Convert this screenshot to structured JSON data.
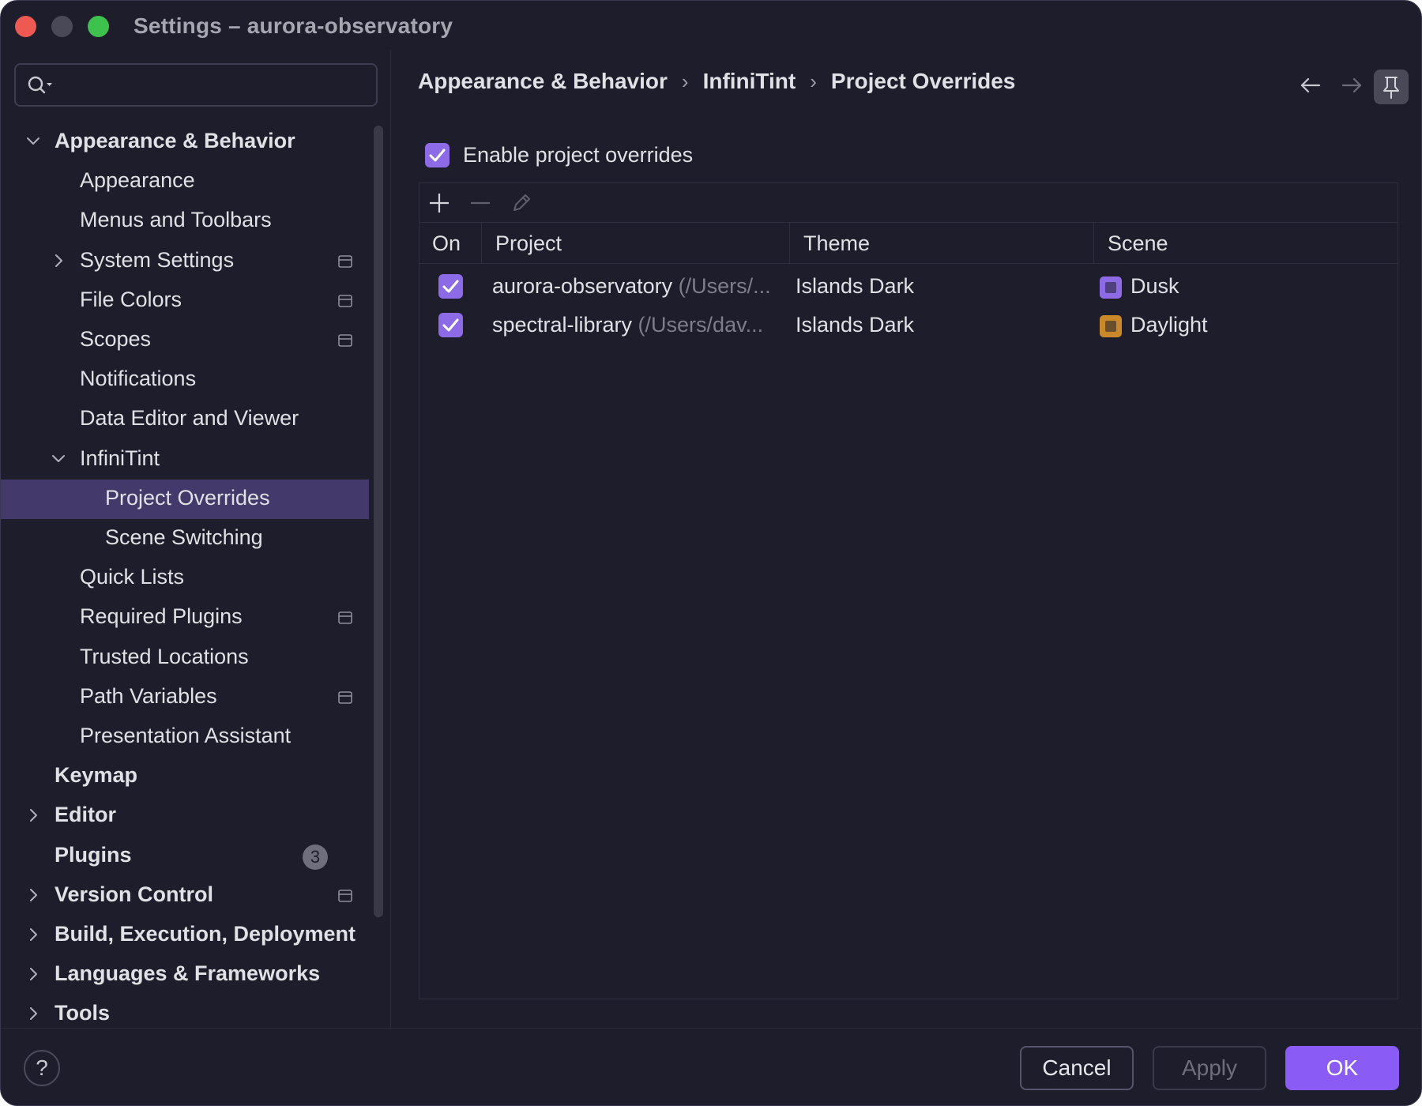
{
  "window": {
    "title": "Settings – aurora-observatory"
  },
  "search": {
    "placeholder": "",
    "value": ""
  },
  "sidebar": {
    "items": [
      {
        "label": "Appearance & Behavior",
        "bold": true,
        "chevron": "down",
        "level": 0
      },
      {
        "label": "Appearance",
        "level": 1
      },
      {
        "label": "Menus and Toolbars",
        "level": 1
      },
      {
        "label": "System Settings",
        "level": 1,
        "chevron": "right",
        "project_icon": true
      },
      {
        "label": "File Colors",
        "level": 1,
        "project_icon": true
      },
      {
        "label": "Scopes",
        "level": 1,
        "project_icon": true
      },
      {
        "label": "Notifications",
        "level": 1
      },
      {
        "label": "Data Editor and Viewer",
        "level": 1
      },
      {
        "label": "InfiniTint",
        "level": 1,
        "chevron": "down"
      },
      {
        "label": "Project Overrides",
        "level": 2,
        "selected": true
      },
      {
        "label": "Scene Switching",
        "level": 2
      },
      {
        "label": "Quick Lists",
        "level": 1
      },
      {
        "label": "Required Plugins",
        "level": 1,
        "project_icon": true
      },
      {
        "label": "Trusted Locations",
        "level": 1
      },
      {
        "label": "Path Variables",
        "level": 1,
        "project_icon": true
      },
      {
        "label": "Presentation Assistant",
        "level": 1
      },
      {
        "label": "Keymap",
        "bold": true,
        "level": 0
      },
      {
        "label": "Editor",
        "bold": true,
        "chevron": "right",
        "level": 0
      },
      {
        "label": "Plugins",
        "bold": true,
        "level": 0,
        "badge": "3"
      },
      {
        "label": "Version Control",
        "bold": true,
        "chevron": "right",
        "level": 0,
        "project_icon": true
      },
      {
        "label": "Build, Execution, Deployment",
        "bold": true,
        "chevron": "right",
        "level": 0
      },
      {
        "label": "Languages & Frameworks",
        "bold": true,
        "chevron": "right",
        "level": 0
      },
      {
        "label": "Tools",
        "bold": true,
        "chevron": "right",
        "level": 0
      }
    ]
  },
  "breadcrumb": [
    "Appearance & Behavior",
    "InfiniTint",
    "Project Overrides"
  ],
  "breadcrumb_separator": "›",
  "icons": {
    "search": "search-icon",
    "back": "arrow-left-icon",
    "forward": "arrow-right-icon",
    "pin": "pin-icon",
    "add": "plus-icon",
    "remove": "minus-icon",
    "edit": "pencil-icon",
    "project_scope": "project-scope-icon"
  },
  "main": {
    "enable_label": "Enable project overrides",
    "enable_checked": true,
    "columns": {
      "on": "On",
      "project": "Project",
      "theme": "Theme",
      "scene": "Scene"
    },
    "rows": [
      {
        "on": true,
        "project": "aurora-observatory",
        "path": " (/Users/...",
        "theme": "Islands Dark",
        "scene": "Dusk",
        "scene_color": "#8e6be6"
      },
      {
        "on": true,
        "project": "spectral-library",
        "path": " (/Users/dav...",
        "theme": "Islands Dark",
        "scene": "Daylight",
        "scene_color": "#c9892b"
      }
    ]
  },
  "footer": {
    "help": "?",
    "cancel": "Cancel",
    "apply": "Apply",
    "ok": "OK"
  },
  "colors": {
    "accent": "#8a5cf5",
    "background": "#1e1d2b",
    "selection": "#433a6b"
  }
}
